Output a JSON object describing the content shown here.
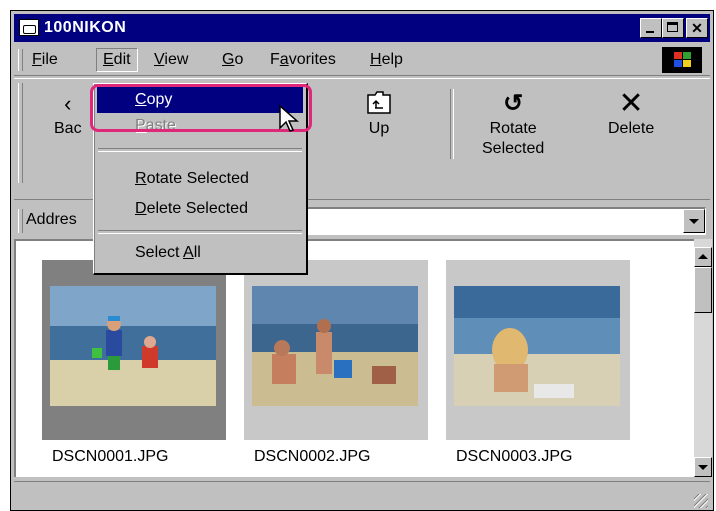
{
  "window": {
    "title": "100NIKON"
  },
  "menubar": {
    "items": [
      {
        "label": "File",
        "u": "F",
        "rest": "ile"
      },
      {
        "label": "Edit",
        "u": "E",
        "rest": "dit"
      },
      {
        "label": "View",
        "u": "V",
        "rest": "iew"
      },
      {
        "label": "Go",
        "u": "G",
        "rest": "o"
      },
      {
        "label": "Favorites",
        "pre": "F",
        "u": "a",
        "rest": "vorites"
      },
      {
        "label": "Help",
        "u": "H",
        "rest": "elp"
      }
    ]
  },
  "toolbar": {
    "back_label": "Bac",
    "up_label": "Up",
    "rotate_label_1": "Rotate",
    "rotate_label_2": "Selected",
    "delete_label": "Delete"
  },
  "address": {
    "label": "Addres"
  },
  "edit_menu": {
    "copy": {
      "u": "C",
      "rest": "opy"
    },
    "paste": {
      "u": "P",
      "rest": "aste"
    },
    "rotate": {
      "u": "R",
      "rest": "otate Selected"
    },
    "delete": {
      "u": "D",
      "rest": "elete Selected"
    },
    "select_all": {
      "pre": "Select ",
      "u": "A",
      "rest": "ll"
    }
  },
  "files": [
    {
      "name": "DSCN0001.JPG",
      "selected": true
    },
    {
      "name": "DSCN0002.JPG",
      "selected": false
    },
    {
      "name": "DSCN0003.JPG",
      "selected": false
    }
  ],
  "colors": {
    "titlebar": "#000080",
    "highlight_ring": "#e0287a",
    "menu_highlight": "#000080"
  }
}
